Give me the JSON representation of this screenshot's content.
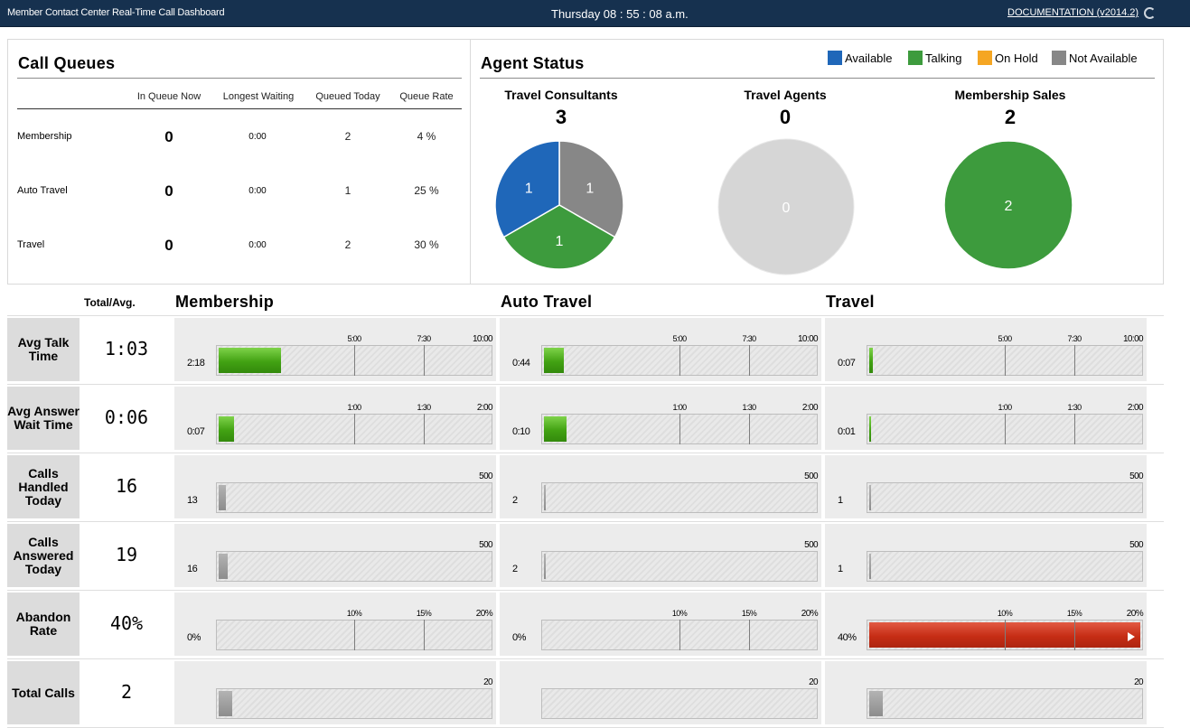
{
  "header": {
    "app_title": "Member Contact Center Real-Time Call Dashboard",
    "clock": "Thursday  08 : 55 : 08 a.m.",
    "documentation": "DOCUMENTATION (v2014.2)"
  },
  "call_queues": {
    "title": "Call Queues",
    "columns": [
      "In Queue Now",
      "Longest Waiting",
      "Queued Today",
      "Queue Rate"
    ],
    "rows": [
      {
        "name": "Membership",
        "in_queue": "0",
        "longest": "0:00",
        "queued": "2",
        "rate": "4 %"
      },
      {
        "name": "Auto Travel",
        "in_queue": "0",
        "longest": "0:00",
        "queued": "1",
        "rate": "25 %"
      },
      {
        "name": "Travel",
        "in_queue": "0",
        "longest": "0:00",
        "queued": "2",
        "rate": "30 %"
      }
    ]
  },
  "agent_status": {
    "title": "Agent Status",
    "legend": [
      {
        "label": "Available",
        "color": "#1f67b9"
      },
      {
        "label": "Talking",
        "color": "#3d9b3d"
      },
      {
        "label": "On Hold",
        "color": "#f5a623"
      },
      {
        "label": "Not Available",
        "color": "#878787"
      }
    ],
    "groups": [
      {
        "name": "Travel Consultants",
        "count": "3",
        "slices": [
          {
            "status": "Available",
            "value": 1
          },
          {
            "status": "Talking",
            "value": 1
          },
          {
            "status": "Not Available",
            "value": 1
          }
        ]
      },
      {
        "name": "Travel Agents",
        "count": "0",
        "slices": [],
        "empty_label": "0",
        "empty_color": "#d6d6d6"
      },
      {
        "name": "Membership Sales",
        "count": "2",
        "slices": [
          {
            "status": "Talking",
            "value": 2
          }
        ]
      }
    ]
  },
  "metrics": {
    "total_header": "Total/Avg.",
    "queues": [
      "Membership",
      "Auto Travel",
      "Travel"
    ],
    "rows": [
      {
        "label": "Avg Talk Time",
        "total": "1:03",
        "max_label": "10:00",
        "ticks": [
          {
            "label": "5:00",
            "frac": 0.5
          },
          {
            "label": "7:30",
            "frac": 0.75
          }
        ],
        "cells": [
          {
            "value": "2:18",
            "fill": 0.23,
            "color": "green"
          },
          {
            "value": "0:44",
            "fill": 0.073,
            "color": "green"
          },
          {
            "value": "0:07",
            "fill": 0.012,
            "color": "green"
          }
        ]
      },
      {
        "label": "Avg Answer Wait Time",
        "total": "0:06",
        "max_label": "2:00",
        "ticks": [
          {
            "label": "1:00",
            "frac": 0.5
          },
          {
            "label": "1:30",
            "frac": 0.75
          }
        ],
        "cells": [
          {
            "value": "0:07",
            "fill": 0.058,
            "color": "green"
          },
          {
            "value": "0:10",
            "fill": 0.083,
            "color": "green"
          },
          {
            "value": "0:01",
            "fill": 0.008,
            "color": "green"
          }
        ]
      },
      {
        "label": "Calls Handled Today",
        "total": "16",
        "max_label": "500",
        "ticks": [],
        "cells": [
          {
            "value": "13",
            "fill": 0.026,
            "color": "gray"
          },
          {
            "value": "2",
            "fill": 0.004,
            "color": "gray"
          },
          {
            "value": "1",
            "fill": 0.002,
            "color": "gray"
          }
        ]
      },
      {
        "label": "Calls Answered Today",
        "total": "19",
        "max_label": "500",
        "ticks": [],
        "cells": [
          {
            "value": "16",
            "fill": 0.032,
            "color": "gray"
          },
          {
            "value": "2",
            "fill": 0.004,
            "color": "gray"
          },
          {
            "value": "1",
            "fill": 0.002,
            "color": "gray"
          }
        ]
      },
      {
        "label": "Abandon Rate",
        "total": "40%",
        "max_label": "20%",
        "ticks": [
          {
            "label": "10%",
            "frac": 0.5
          },
          {
            "label": "15%",
            "frac": 0.75
          }
        ],
        "cells": [
          {
            "value": "0%",
            "fill": 0,
            "color": "red"
          },
          {
            "value": "0%",
            "fill": 0,
            "color": "red"
          },
          {
            "value": "40%",
            "fill": 1.0,
            "color": "red",
            "overflow": true
          }
        ]
      },
      {
        "label": "Total Calls",
        "total": "2",
        "max_label": "20",
        "ticks": [],
        "cells": [
          {
            "value": "",
            "fill": 0.05,
            "color": "gray"
          },
          {
            "value": "",
            "fill": 0.0,
            "color": "gray"
          },
          {
            "value": "",
            "fill": 0.05,
            "color": "gray"
          }
        ]
      }
    ]
  }
}
